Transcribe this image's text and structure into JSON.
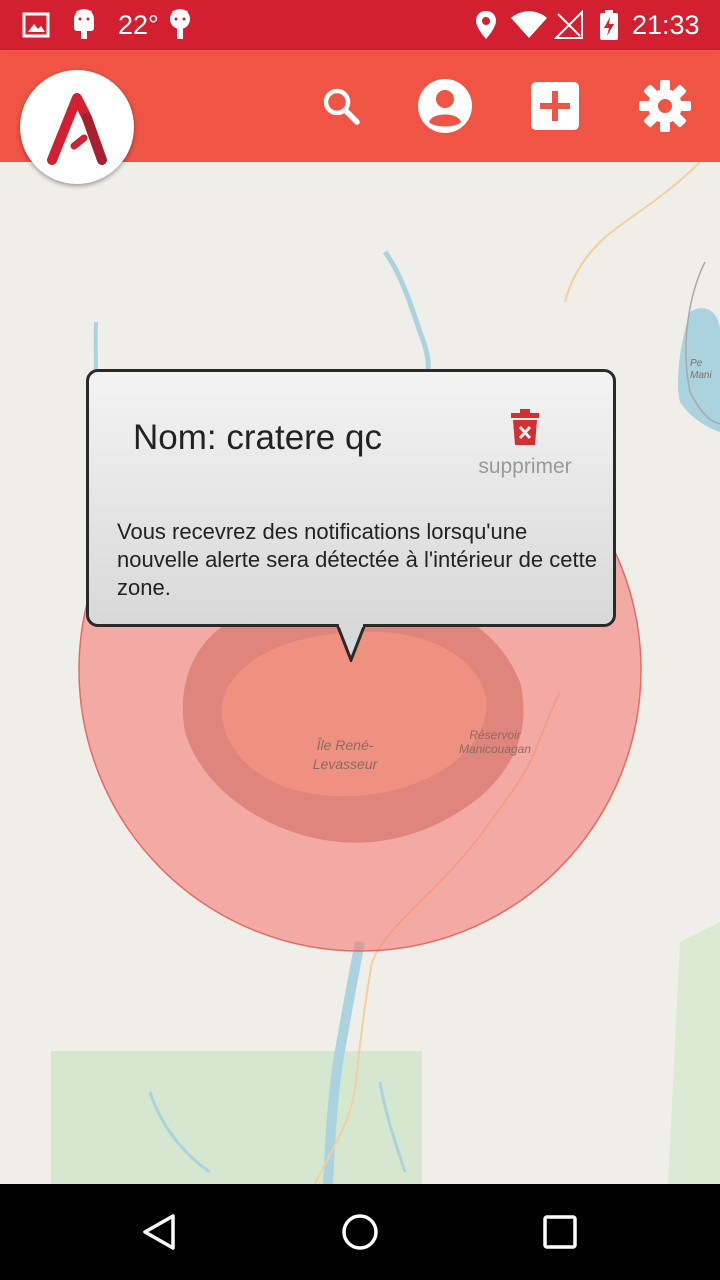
{
  "status_bar": {
    "temperature": "22°",
    "time": "21:33",
    "icons": [
      "image-icon",
      "android-icon",
      "android-icon",
      "location-icon",
      "wifi-icon",
      "no-signal-icon",
      "battery-charging-icon"
    ]
  },
  "app_bar": {
    "logo_icon": "app-logo-icon",
    "actions": [
      "search-icon",
      "account-icon",
      "add-box-icon",
      "settings-icon"
    ]
  },
  "colors": {
    "status_bar": "#d32030",
    "app_bar": "#ef5445",
    "zone_fill": "#f5a19b",
    "delete": "#d32f2f"
  },
  "popup": {
    "title": "Nom: cratere qc",
    "delete_label": "supprimer",
    "message": "Vous recevrez des notifications lorsqu'une nouvelle alerte sera détectée à l'intérieur de cette zone."
  },
  "map": {
    "labels": {
      "island_line1": "Île René-",
      "island_line2": "Levasseur",
      "reservoir_line1": "Réservoir",
      "reservoir_line2": "Manicouagan",
      "edge_top_right_1": "Pe",
      "edge_top_right_2": "Mani"
    }
  },
  "nav_bar": {
    "buttons": [
      "back-icon",
      "home-icon",
      "recents-icon"
    ]
  }
}
